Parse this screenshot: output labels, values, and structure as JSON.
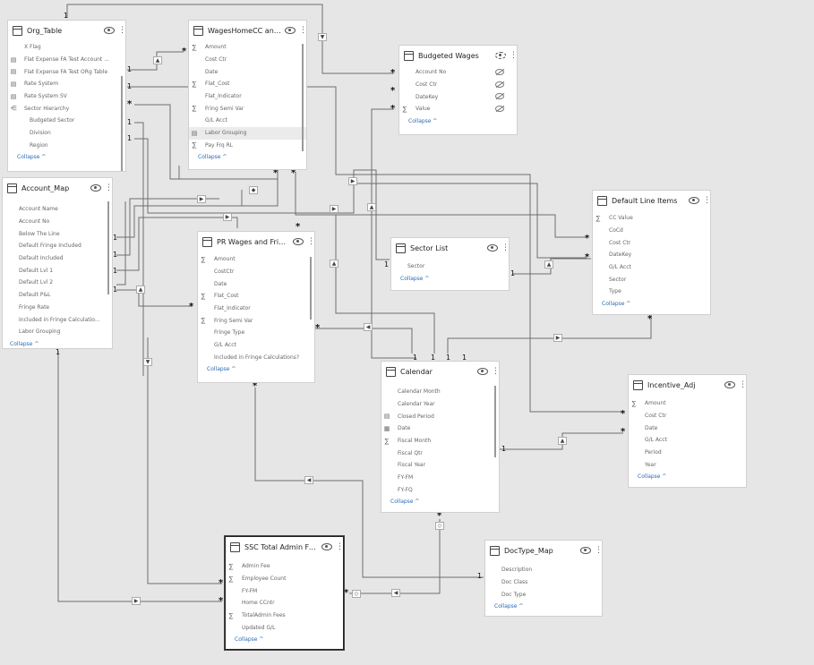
{
  "tables": {
    "org_table": {
      "title": "Org_Table",
      "fields": [
        "X Flag",
        "Flat Expense FA Test Account ...",
        "Flat Expense FA Test ORg Table",
        "Rate System",
        "Rate System SV",
        "Sector Hierarchy",
        "Budgeted Sector",
        "Division",
        "Region"
      ],
      "collapse": "Collapse"
    },
    "wages_home": {
      "title": "WagesHomeCC and F...",
      "fields": [
        "Amount",
        "Cost Ctr",
        "Date",
        "Flat_Cost",
        "Flat_Indicator",
        "Fring Semi Var",
        "G/L Acct",
        "Labor Grouping",
        "Pay Frq RL"
      ],
      "collapse": "Collapse"
    },
    "budgeted_wages": {
      "title": "Budgeted Wages",
      "fields": [
        "Account No",
        "Cost Ctr",
        "DateKey",
        "Value"
      ],
      "collapse": "Collapse"
    },
    "account_map": {
      "title": "Account_Map",
      "fields": [
        "Account Name",
        "Account No",
        "Below The Line",
        "Default Fringe Included",
        "Default Included",
        "Default Lvl 1",
        "Default Lvl 2",
        "Default P&L",
        "Fringe Rate",
        "Included in Fringe Calculatio...",
        "Labor Grouping"
      ],
      "collapse": "Collapse"
    },
    "pr_wages": {
      "title": "PR Wages and Fringe ...",
      "fields": [
        "Amount",
        "CostCtr",
        "Date",
        "Flat_Cost",
        "Flat_Indicator",
        "Fring Semi Var",
        "Fringe Type",
        "G/L Acct",
        "Included in Fringe Calculations?"
      ],
      "collapse": "Collapse"
    },
    "sector_list": {
      "title": "Sector List",
      "fields": [
        "Sector"
      ],
      "collapse": "Collapse"
    },
    "default_line_items": {
      "title": "Default Line Items",
      "fields": [
        "CC Value",
        "CoCd",
        "Cost Ctr",
        "DateKey",
        "G/L Acct",
        "Sector",
        "Type"
      ],
      "collapse": "Collapse"
    },
    "calendar": {
      "title": "Calendar",
      "fields": [
        "Calendar Month",
        "Calendar Year",
        "Closed Period",
        "Date",
        "Fiscal Month",
        "Fiscal Qtr",
        "Fiscal Year",
        "FY-FM",
        "FY-FQ"
      ],
      "collapse": "Collapse"
    },
    "incentive_adj": {
      "title": "Incentive_Adj",
      "fields": [
        "Amount",
        "Cost Ctr",
        "Date",
        "G/L Acct",
        "Period",
        "Year"
      ],
      "collapse": "Collapse"
    },
    "ssc_admin": {
      "title": "SSC Total Admin Fees",
      "fields": [
        "Admin Fee",
        "Employee Count",
        "FY-FM",
        "Home CCntr",
        "TotalAdmin Fees",
        "Updated G/L"
      ],
      "collapse": "Collapse"
    },
    "doctype_map": {
      "title": "DocType_Map",
      "fields": [
        "Description",
        "Doc Class",
        "Doc Type"
      ],
      "collapse": "Collapse"
    }
  },
  "cardinality": {
    "one": "1",
    "many": "*"
  },
  "icon_names": [
    "table-icon",
    "eye-icon",
    "more-icon",
    "sigma-icon",
    "hierarchy-icon",
    "calendar-icon",
    "hidden-eye-icon",
    "collapse-chevron-icon"
  ]
}
